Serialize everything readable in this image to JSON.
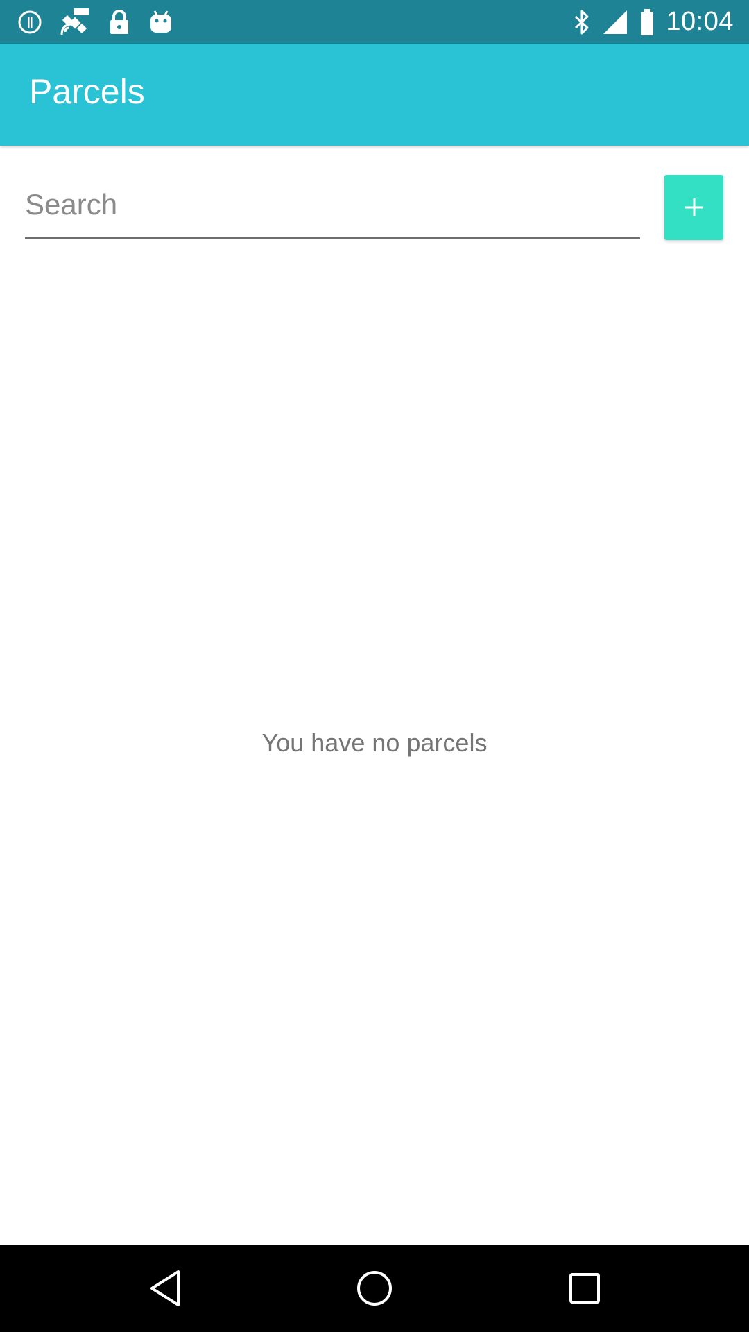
{
  "status_bar": {
    "time": "10:04",
    "left_icons": [
      "info-circle-icon",
      "fake-gps-satellite-icon",
      "lock-icon",
      "android-icon"
    ],
    "right_icons": [
      "bluetooth-icon",
      "signal-icon",
      "battery-icon"
    ]
  },
  "app_bar": {
    "title": "Parcels",
    "color": "#29c3d5"
  },
  "search": {
    "placeholder": "Search",
    "value": ""
  },
  "add_button": {
    "icon": "plus-icon",
    "color": "#33e0c4"
  },
  "main": {
    "empty_message": "You have no parcels"
  },
  "nav_bar": {
    "buttons": [
      "back-icon",
      "home-icon",
      "recents-icon"
    ]
  }
}
